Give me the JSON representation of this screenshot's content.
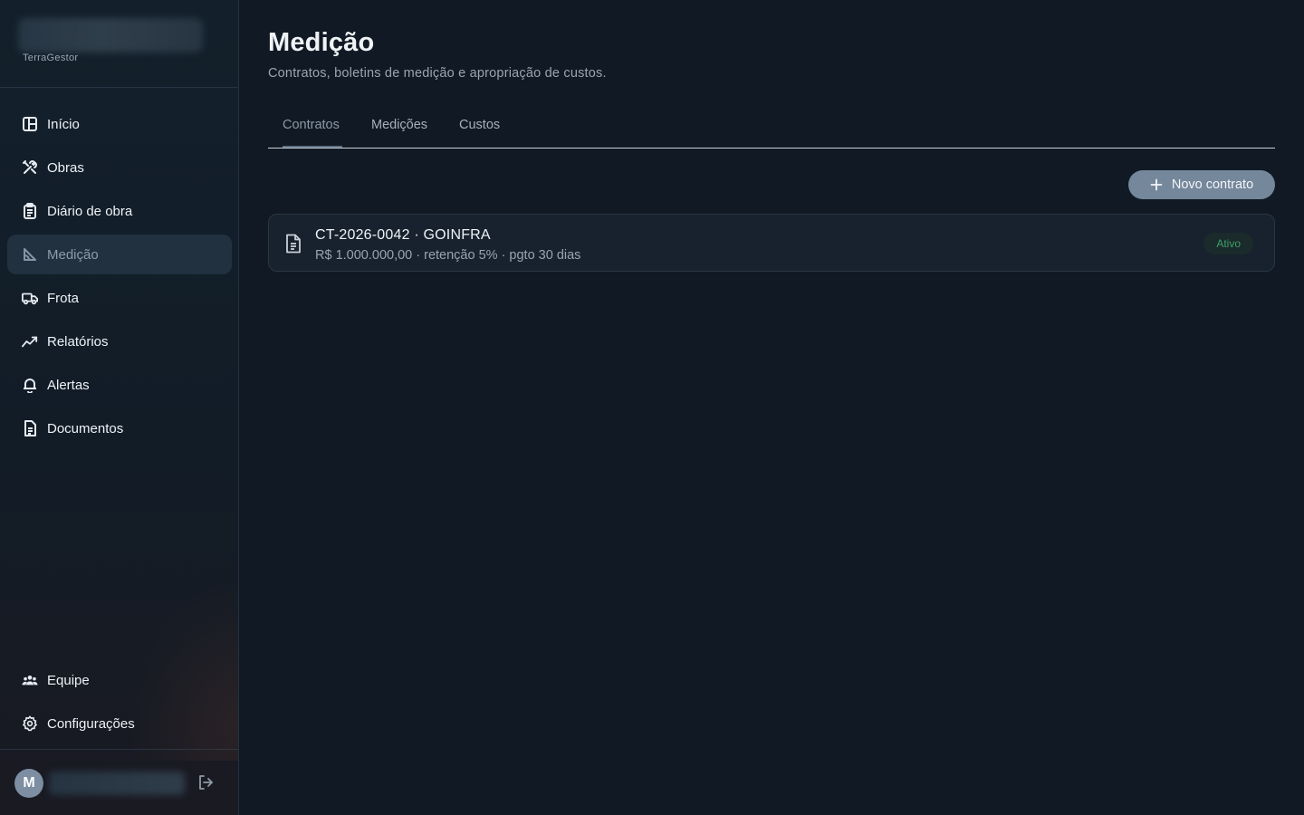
{
  "brand": {
    "name": "TerraGestor"
  },
  "sidebar": {
    "items": [
      {
        "label": "Início",
        "icon": "dashboard-icon"
      },
      {
        "label": "Obras",
        "icon": "tools-icon"
      },
      {
        "label": "Diário de obra",
        "icon": "clipboard-icon"
      },
      {
        "label": "Medição",
        "icon": "ruler-angle-icon",
        "active": true
      },
      {
        "label": "Frota",
        "icon": "truck-icon"
      },
      {
        "label": "Relatórios",
        "icon": "trend-chart-icon"
      },
      {
        "label": "Alertas",
        "icon": "bell-icon"
      },
      {
        "label": "Documentos",
        "icon": "document-icon"
      }
    ],
    "bottom_items": [
      {
        "label": "Equipe",
        "icon": "users-icon"
      },
      {
        "label": "Configurações",
        "icon": "gear-icon"
      }
    ]
  },
  "user": {
    "initial": "M"
  },
  "page": {
    "title": "Medição",
    "subtitle": "Contratos, boletins de medição e apropriação de custos."
  },
  "tabs": [
    {
      "label": "Contratos",
      "active": true
    },
    {
      "label": "Medições"
    },
    {
      "label": "Custos"
    }
  ],
  "actions": {
    "new_contract": "Novo contrato"
  },
  "contracts": [
    {
      "title": "CT-2026-0042 · GOINFRA",
      "details": "R$ 1.000.000,00 · retenção 5% · pgto 30 dias",
      "status": "Ativo"
    }
  ],
  "colors": {
    "accent": "#75879b",
    "status_active": "#3f9e6b",
    "background": "#111a24"
  }
}
